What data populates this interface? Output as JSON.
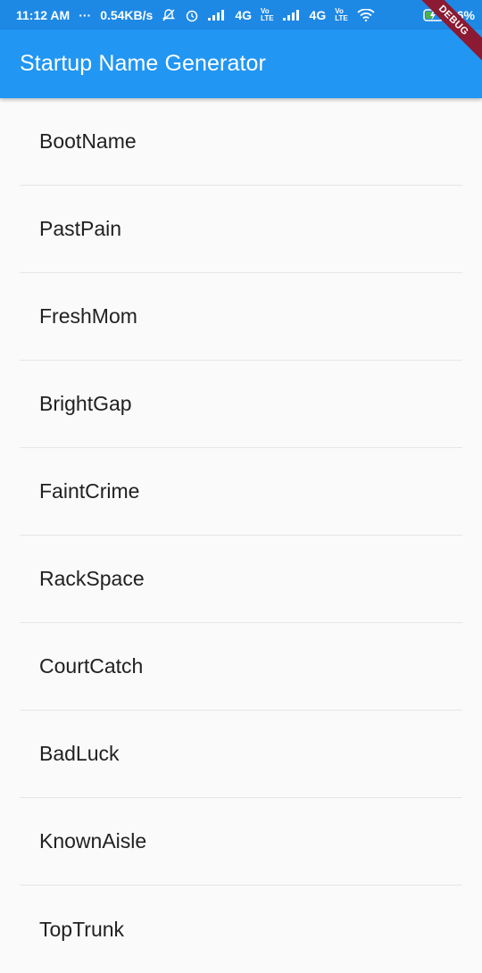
{
  "status_bar": {
    "time": "11:12 AM",
    "dots": "···",
    "speed": "0.54KB/s",
    "network_1": "4G",
    "network_2": "4G",
    "battery": "46%",
    "icons": [
      "mute-bell-icon",
      "alarm-icon",
      "signal-icon",
      "volte-icon",
      "signal-icon",
      "volte-icon",
      "wifi-icon",
      "battery-charging-icon"
    ]
  },
  "app_bar": {
    "title": "Startup Name Generator",
    "color": "#2196f3"
  },
  "debug_banner": {
    "label": "DEBUG",
    "color": "#8b1a32"
  },
  "list": {
    "items": [
      "BootName",
      "PastPain",
      "FreshMom",
      "BrightGap",
      "FaintCrime",
      "RackSpace",
      "CourtCatch",
      "BadLuck",
      "KnownAisle",
      "TopTrunk"
    ]
  }
}
